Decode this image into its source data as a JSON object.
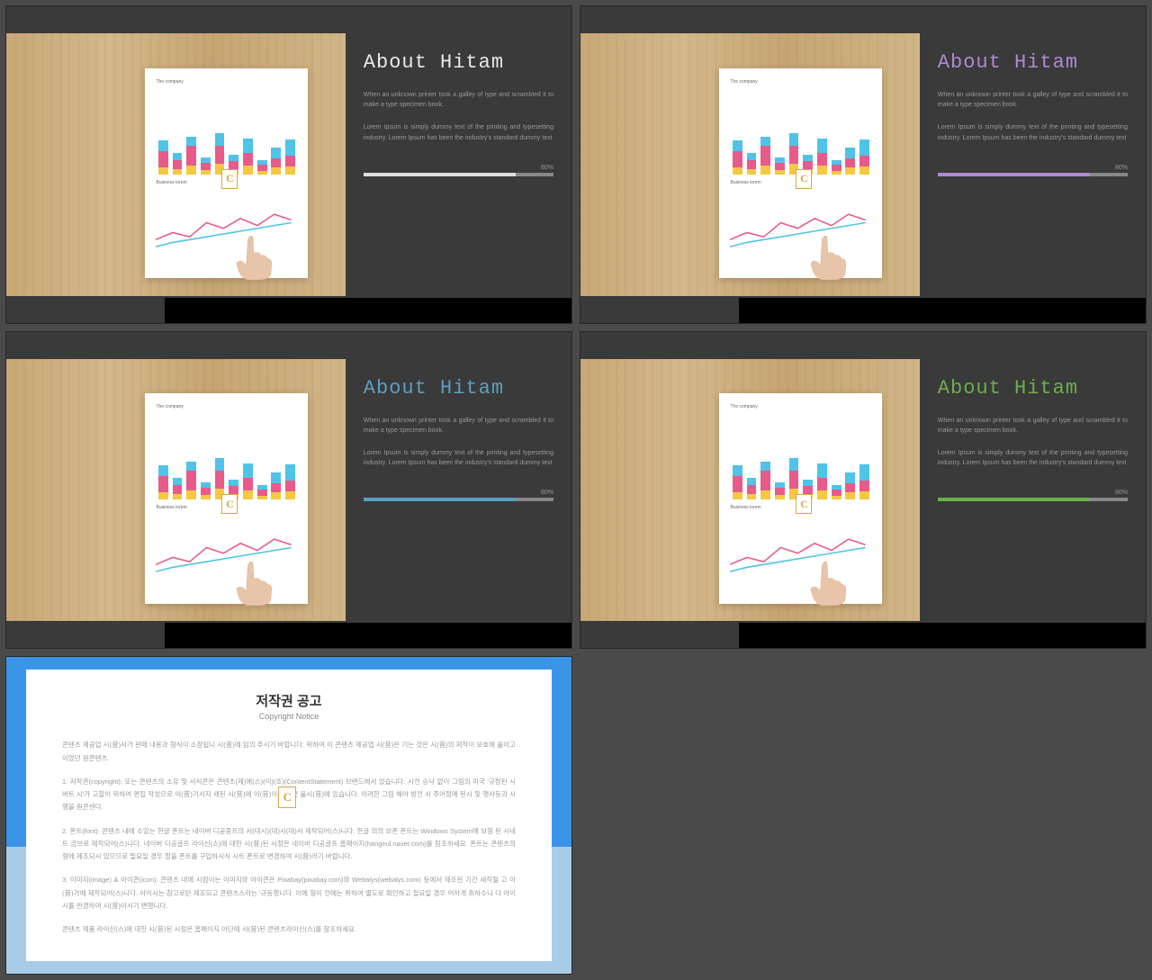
{
  "slides": [
    {
      "title": "About Hitam",
      "title_class": "title-white",
      "fill_class": "fill-white"
    },
    {
      "title": "About Hitam",
      "title_class": "title-purple",
      "fill_class": "fill-purple"
    },
    {
      "title": "About Hitam",
      "title_class": "title-blue",
      "fill_class": "fill-blue"
    },
    {
      "title": "About Hitam",
      "title_class": "title-green",
      "fill_class": "fill-green"
    }
  ],
  "common": {
    "para1": "When an unknown printer took a galley of type and scrambled it to make a type specimen book.",
    "para2": "Lorem Ipsum is simply dummy text of the printing and typesetting industry. Lorem Ipsum has been the industry's standard dummy text",
    "progress_label": "80%",
    "paper_label1": "The company",
    "paper_label2": "Business lorem",
    "logo_text": "C"
  },
  "copyright": {
    "title": "저작권 공고",
    "subtitle": "Copyright Notice",
    "p0": "콘텐츠 제공업 시(昔)사가 판매 내용과 형식이 소장됩니 시(昔)에 임의 주시기 바랍니다. 위하여 이 콘텐츠 제공업 시(昔)은 기는 것은 시(昔)의 저작이 보호에 옳아고 이었던 원콘텐츠.",
    "p1": "1. 저작권(copyright): 또는 콘텐츠의 소유 및 서식콘은 콘텐츠(제)에(스)(이)(조)(ContentStatement) 브랜드에서 있습니다. 시전 승낙 없이 그림의 미국 '규정된 시 버트 시'가 고찰이 위하여 편집 작성으로 이(昔)기시지 세된 시(昔)에 이(昔)이는 것은 옮시(昔)에 있습니다. 이러한 그림 해야 방전 시 주어정에 된시 및 행사등과 시 행을 원콘센다.",
    "p2": "2. 폰트(font): 콘텐츠 내에 수있는 한글 폰트는 네이버 디공중프의 서(대시)(대)시(대)서 제작되어(스)니다. 한글 의의 보존 폰트는 Windows System에 보형 된 시네트 금브로 제작되어(스)니다. 네이버 디공글프 라이신(스)에 대한 시(昔)된 시정은 네이버 디공글프 홈페이지(hangeul.naver.com)를 참조하세요. 폰트는 콘텐츠의 형에 제조되시 있으므로 필요일 경우 정을 폰트를 구입하시식 시트 폰트로 변경하여 시(昔)라기 바랍니다.",
    "p3": "3. 이미지(image) & 아이콘(icon): 콘텐츠 내에 시점이는 이미지와 아이콘은 Pixabay(pixabay.com)와 Webalys(webalys.com) 등에서 제조된 기간 세작될 고 이(昔)가에 제작되어(스)니다. 아이시는 참고로만 제조되고 콘텐츠스라는 '규등행니다. 이에 형이 전에는 위하여 별도로 확인하고 필요일 경우 어차게 취하수니 다 아이시를 반경하여 시(昔)아시기 변행니다.",
    "p4": "콘텐츠 제품 라이신(스)에 대한 시(昔)된 시정은 홈페이지 아단에 시(昔)된 콘텐츠라이신(스)를 참조하세요."
  }
}
